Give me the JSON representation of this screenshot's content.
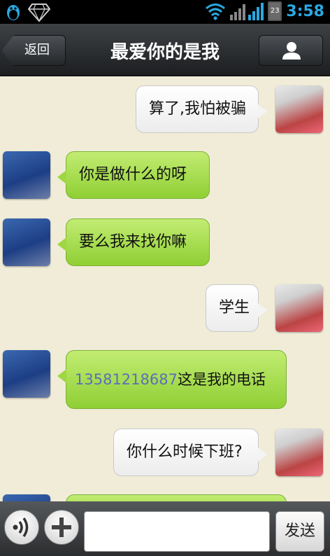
{
  "statusbar": {
    "time": "3:58",
    "battery_level": "23",
    "icons": [
      "qq-penguin-icon",
      "diamond-icon",
      "wifi-icon",
      "signal-icon",
      "battery-icon"
    ]
  },
  "header": {
    "back_label": "返回",
    "title": "最爱你的是我",
    "profile_icon": "person-icon"
  },
  "messages": [
    {
      "side": "me",
      "text": "算了,我怕被骗"
    },
    {
      "side": "him",
      "text": "你是做什么的呀"
    },
    {
      "side": "him",
      "text": "要么我来找你嘛"
    },
    {
      "side": "me",
      "text": "学生"
    },
    {
      "side": "him",
      "phone": "13581218687",
      "text": "这是我的电话"
    },
    {
      "side": "me",
      "text": "你什么时候下班?"
    }
  ],
  "inputbar": {
    "voice_icon": "voice-icon",
    "plus_icon": "plus-icon",
    "input_value": "",
    "send_label": "发送"
  },
  "colors": {
    "background": "#f1ecd8",
    "bubble_him": "#9fd743",
    "bubble_me": "#ffffff",
    "time_color": "#2aa8e0",
    "phone_link": "#5b6fb8"
  }
}
